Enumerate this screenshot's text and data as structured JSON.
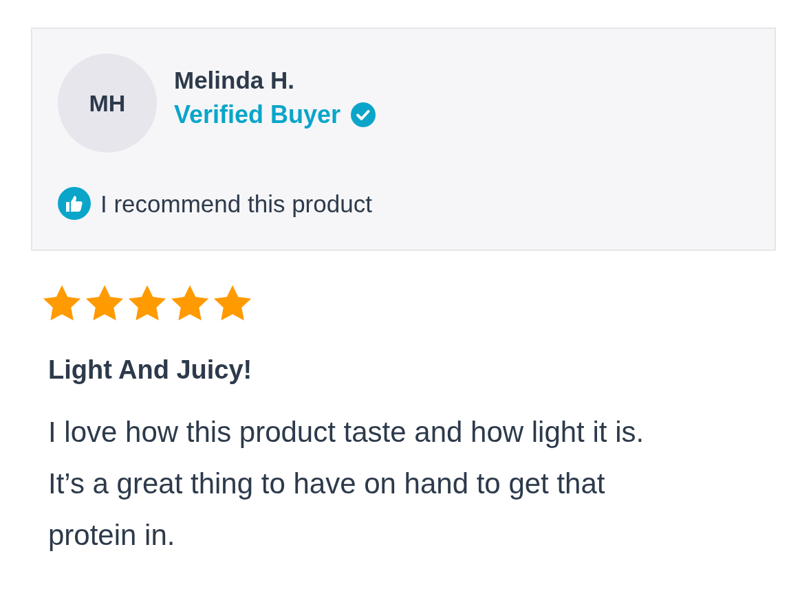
{
  "reviewer": {
    "initials": "MH",
    "name": "Melinda H.",
    "badge": "Verified Buyer",
    "verified": true
  },
  "recommendation": {
    "recommends": true,
    "text": "I recommend this product"
  },
  "review": {
    "stars": 5,
    "title": "Light And Juicy!",
    "body": "I love how this product taste and how light it is. It’s a great thing to have on hand to get that protein in."
  }
}
